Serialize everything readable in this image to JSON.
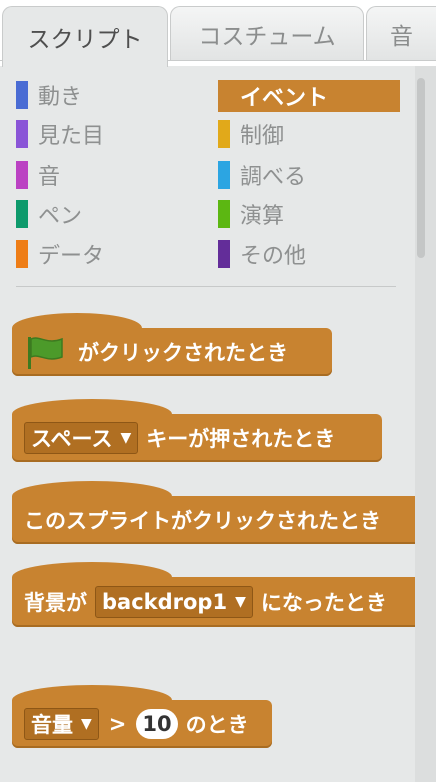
{
  "tabs": [
    {
      "label": "スクリプト",
      "active": true
    },
    {
      "label": "コスチューム",
      "active": false
    },
    {
      "label": "音",
      "active": false
    }
  ],
  "categories": {
    "left": [
      {
        "label": "動き",
        "color": "#4a6cd4"
      },
      {
        "label": "見た目",
        "color": "#8a55d7"
      },
      {
        "label": "音",
        "color": "#bb42c3"
      },
      {
        "label": "ペン",
        "color": "#0e9a6c"
      },
      {
        "label": "データ",
        "color": "#ee7d16"
      }
    ],
    "right": [
      {
        "label": "イベント",
        "color": "#c88330",
        "selected": true
      },
      {
        "label": "制御",
        "color": "#e1a91a"
      },
      {
        "label": "調べる",
        "color": "#2ca5e2"
      },
      {
        "label": "演算",
        "color": "#5cb712"
      },
      {
        "label": "その他",
        "color": "#632d99"
      }
    ]
  },
  "blocks": {
    "flag_clicked": {
      "label": "がクリックされたとき",
      "icon": "green-flag-icon"
    },
    "key_pressed": {
      "dropdown": "スペース",
      "label": "キーが押されたとき"
    },
    "sprite_clicked": {
      "label": "このスプライトがクリックされたとき"
    },
    "backdrop_switch": {
      "prefix": "背景が",
      "dropdown": "backdrop1",
      "label": "になったとき"
    },
    "sensor_greater": {
      "dropdown": "音量",
      "operator": ">",
      "value": "10",
      "label": "のとき"
    }
  },
  "colors": {
    "events": "#c88330",
    "flag": "#4c9a2a"
  }
}
